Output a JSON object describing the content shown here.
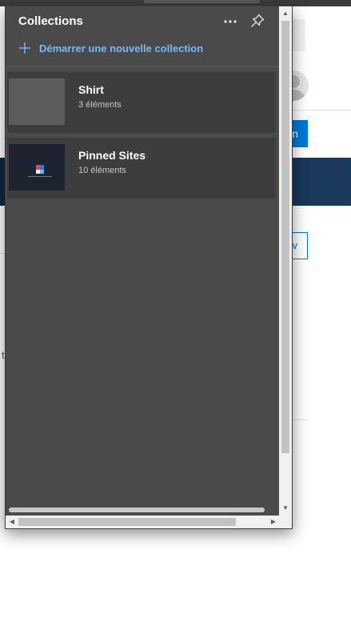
{
  "background_page": {
    "signin_partial": "n",
    "outline_partial": "v",
    "stray_text": "t"
  },
  "collections_pane": {
    "title": "Collections",
    "more_icon": "more-horizontal-icon",
    "pin_icon": "pin-icon",
    "new_collection_label": "Démarrer une nouvelle collection",
    "items": [
      {
        "name": "Shirt",
        "count": "3 éléments"
      },
      {
        "name": "Pinned Sites",
        "count": "10 éléments"
      }
    ]
  },
  "colors": {
    "pane_background": "#4a4a4a",
    "card_background": "#3d3d3d",
    "accent_link": "#79b8f4",
    "primary_button": "#0078d4"
  }
}
